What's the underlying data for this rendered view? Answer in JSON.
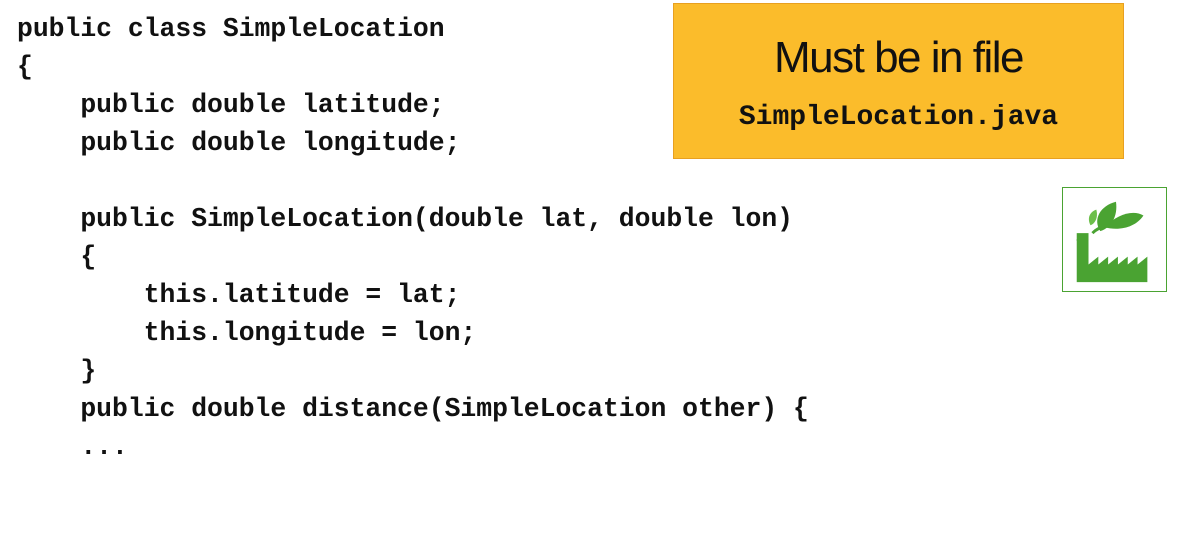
{
  "code": {
    "lines": [
      "public class SimpleLocation",
      "{",
      "    public double latitude;",
      "    public double longitude;",
      "",
      "    public SimpleLocation(double lat, double lon)",
      "    {",
      "        this.latitude = lat;",
      "        this.longitude = lon;",
      "    }",
      "    public double distance(SimpleLocation other) {",
      "    ..."
    ]
  },
  "callout": {
    "title": "Must be in file",
    "filename": "SimpleLocation.java",
    "background": "#fbbc2b"
  },
  "logo": {
    "icon": "factory-leaf-icon",
    "color": "#4aa332"
  }
}
